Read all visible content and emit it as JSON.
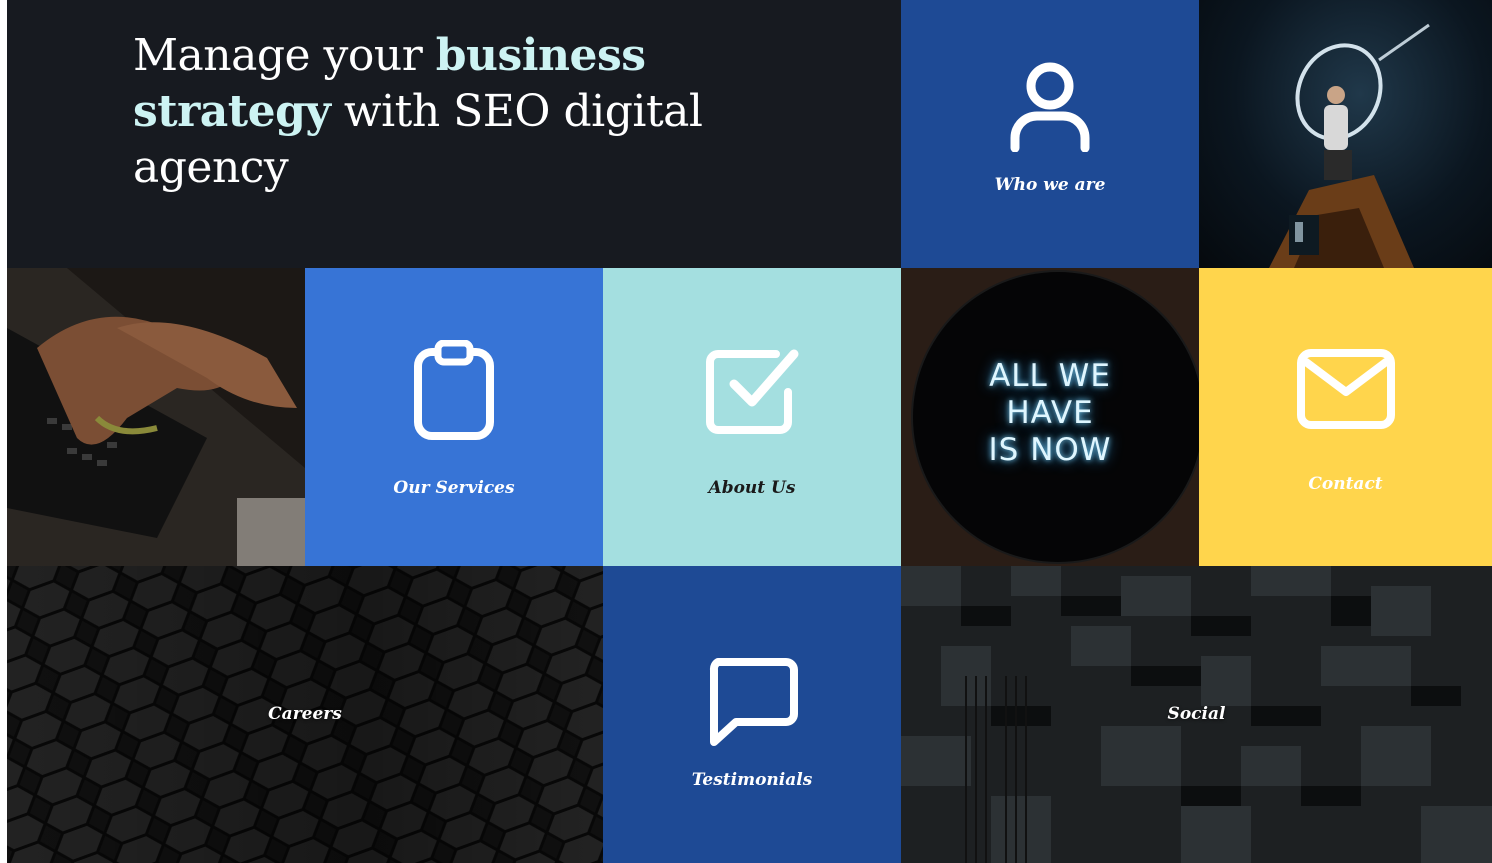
{
  "hero": {
    "title_part1": "Manage your ",
    "title_bold1": "business",
    "title_part2": " ",
    "title_bold2": "strategy",
    "title_part3": " with SEO digital agency"
  },
  "tiles": {
    "who": {
      "label": "Who we are",
      "icon": "user-icon",
      "color": "#1e4a95"
    },
    "services": {
      "label": "Our Services",
      "icon": "clipboard-icon",
      "color": "#3774d6"
    },
    "about": {
      "label": "About Us",
      "icon": "checkbox-icon",
      "color": "#a4dfe0"
    },
    "contact": {
      "label": "Contact",
      "icon": "mail-icon",
      "color": "#ffd54c"
    },
    "testimonials": {
      "label": "Testimonials",
      "icon": "speech-bubble-icon",
      "color": "#1e4a95"
    },
    "careers": {
      "label": "Careers"
    },
    "social": {
      "label": "Social"
    }
  },
  "photos": {
    "neon_sign": {
      "line1": "ALL WE",
      "line2": "HAVE",
      "line3": "IS NOW"
    }
  }
}
